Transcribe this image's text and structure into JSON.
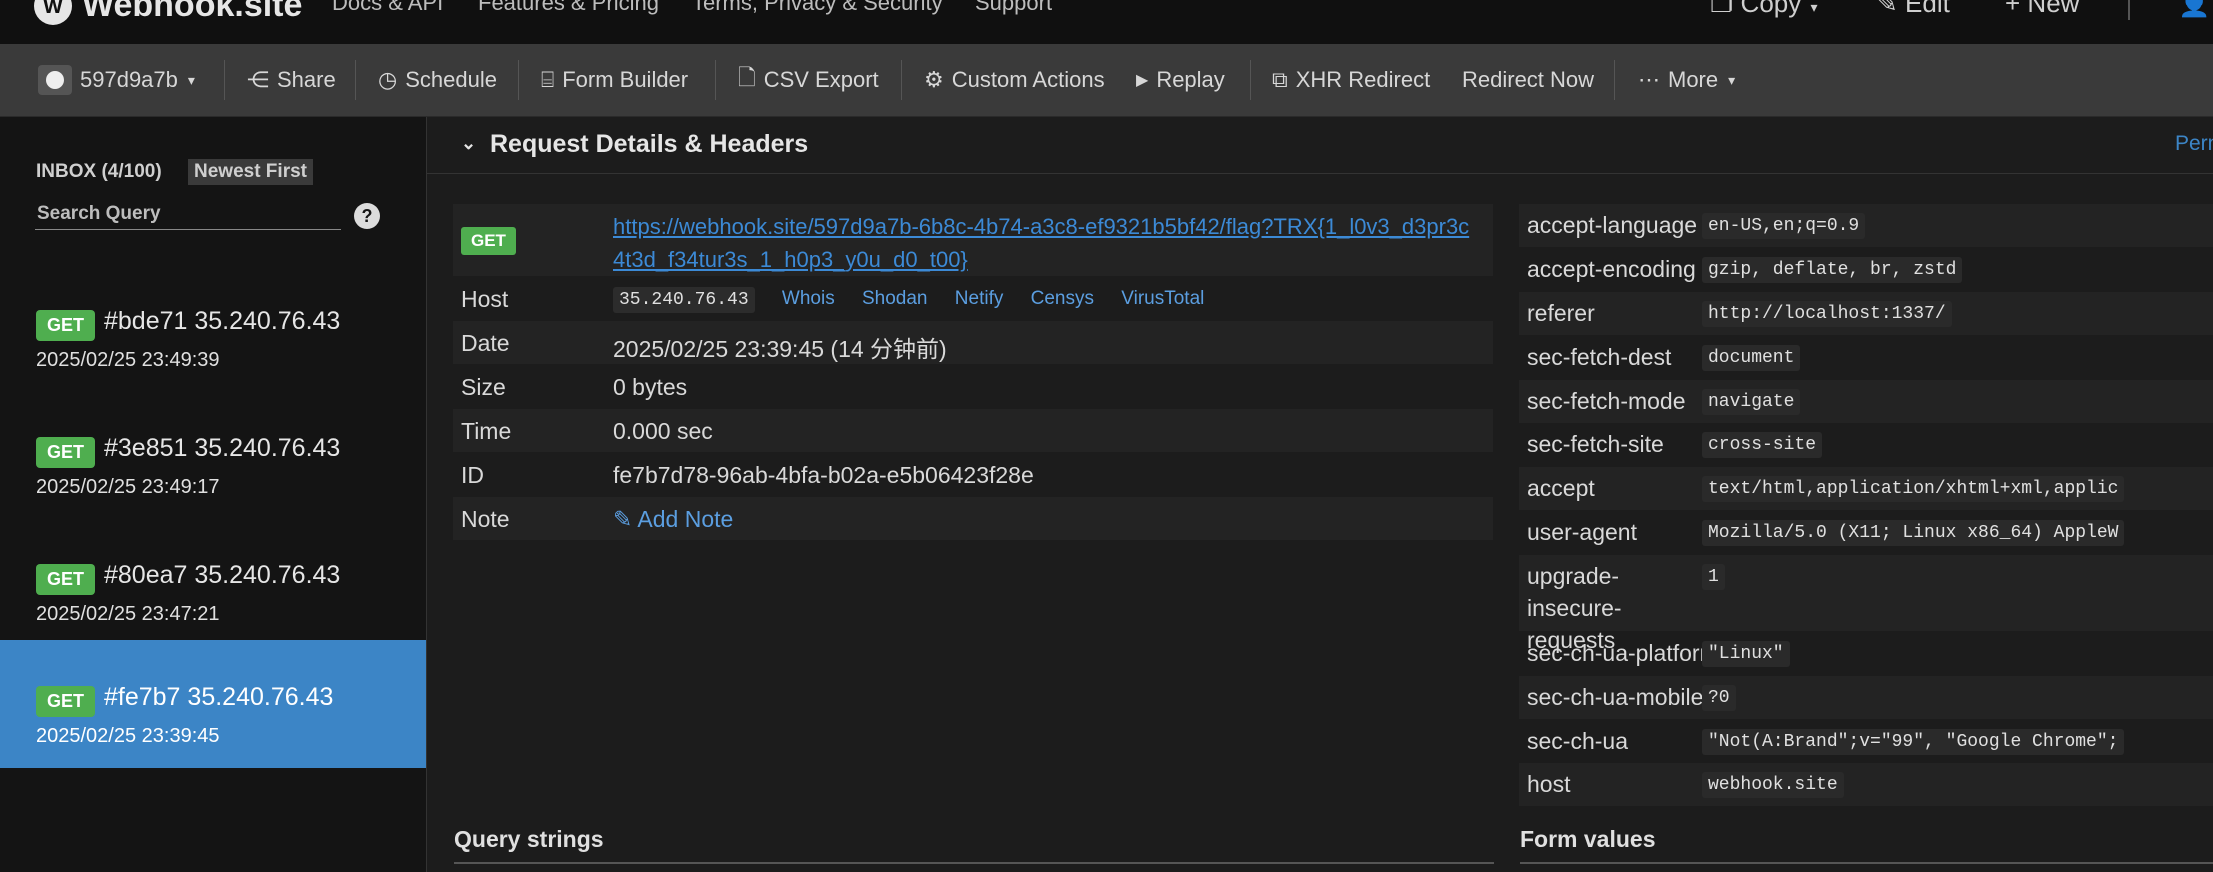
{
  "topbar": {
    "brand": "Webhook.site",
    "nav": [
      "Docs & API",
      "Features & Pricing",
      "Terms, Privacy & Security",
      "Support"
    ],
    "actions": [
      "Copy",
      "Edit",
      "New"
    ]
  },
  "toolbar": {
    "token": "597d9a7b",
    "items": [
      "Share",
      "Schedule",
      "Form Builder",
      "CSV Export",
      "Custom Actions",
      "Replay",
      "XHR Redirect",
      "Redirect Now",
      "More"
    ]
  },
  "sidebar": {
    "inbox_label": "INBOX (4/100)",
    "sort_label": "Newest First",
    "search_placeholder": "Search Query",
    "help": "?",
    "requests": [
      {
        "method": "GET",
        "title": "#bde71 35.240.76.43",
        "time": "2025/02/25 23:49:39",
        "active": false
      },
      {
        "method": "GET",
        "title": "#3e851 35.240.76.43",
        "time": "2025/02/25 23:49:17",
        "active": false
      },
      {
        "method": "GET",
        "title": "#80ea7 35.240.76.43",
        "time": "2025/02/25 23:47:21",
        "active": false
      },
      {
        "method": "GET",
        "title": "#fe7b7 35.240.76.43",
        "time": "2025/02/25 23:39:45",
        "active": true
      }
    ]
  },
  "details": {
    "section_title": "Request Details & Headers",
    "permalink": "Permalink",
    "method": "GET",
    "url": "https://webhook.site/597d9a7b-6b8c-4b74-a3c8-ef9321b5bf42/flag?TRX{1_l0v3_d3pr3c4t3d_f34tur3s_1_h0p3_y0u_d0_t00}",
    "host_label": "Host",
    "host_ip": "35.240.76.43",
    "host_tools": [
      "Whois",
      "Shodan",
      "Netify",
      "Censys",
      "VirusTotal"
    ],
    "date_label": "Date",
    "date": "2025/02/25 23:39:45 (14 分钟前)",
    "size_label": "Size",
    "size": "0 bytes",
    "time_label": "Time",
    "time": "0.000 sec",
    "id_label": "ID",
    "id": "fe7b7d78-96ab-4bfa-b02a-e5b06423f28e",
    "note_label": "Note",
    "add_note": "Add Note"
  },
  "headers": [
    {
      "key": "accept-language",
      "value": "en-US,en;q=0.9"
    },
    {
      "key": "accept-encoding",
      "value": "gzip, deflate, br, zstd"
    },
    {
      "key": "referer",
      "value": "http://localhost:1337/"
    },
    {
      "key": "sec-fetch-dest",
      "value": "document"
    },
    {
      "key": "sec-fetch-mode",
      "value": "navigate"
    },
    {
      "key": "sec-fetch-site",
      "value": "cross-site"
    },
    {
      "key": "accept",
      "value": "text/html,application/xhtml+xml,applic"
    },
    {
      "key": "user-agent",
      "value": "Mozilla/5.0 (X11; Linux x86_64) AppleW"
    },
    {
      "key": "upgrade-insecure-requests",
      "value": "1"
    },
    {
      "key": "sec-ch-ua-platform",
      "value": "\"Linux\""
    },
    {
      "key": "sec-ch-ua-mobile",
      "value": "?0"
    },
    {
      "key": "sec-ch-ua",
      "value": "\"Not(A:Brand\";v=\"99\", \"Google Chrome\";"
    },
    {
      "key": "host",
      "value": "webhook.site"
    }
  ],
  "query_strings_title": "Query strings",
  "form_values_title": "Form values"
}
